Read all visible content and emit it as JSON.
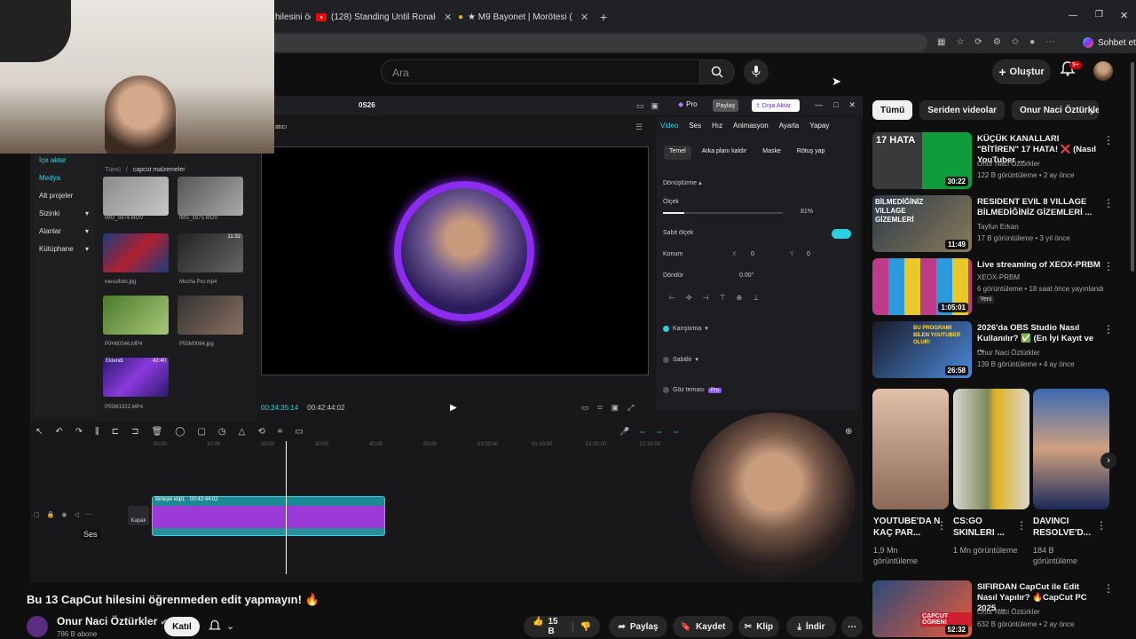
{
  "browser": {
    "tabs": [
      {
        "title": "hilesini öğ"
      },
      {
        "title": "(128) Standing Until Ronaldo Score"
      },
      {
        "title": "★ M9 Bayonet | Morötesi (Görevde"
      }
    ],
    "sohbet_label": "Sohbet et"
  },
  "youtube": {
    "search_placeholder": "Ara",
    "create_label": "Oluştur",
    "notif_count": "9+"
  },
  "capcut": {
    "title": "0S26",
    "pro_label": "Pro",
    "share_label": "Paylaş",
    "export_label": "Dışa Aktar",
    "player_label": "atıcı",
    "nav": [
      "İçe aktar",
      "Medya",
      "Alt projeler",
      "Sizinki",
      "Alanlar",
      "Kütüphane"
    ],
    "breadcrumb": [
      "Tümü",
      "capcut malzemeler"
    ],
    "media": [
      {
        "name": "IMG_5974.MOV"
      },
      {
        "name": "IMG_5975.MOV"
      },
      {
        "name": "messifoto.jpg"
      },
      {
        "name": "Mocha Pro.mp4"
      },
      {
        "name": "P0H60546.MP4"
      },
      {
        "name": "P55M0064.jpg"
      },
      {
        "name": "P55M1922.MP4"
      }
    ],
    "media_extra": {
      "tile4_time": "11:32",
      "tile7_added": "Eklendi",
      "tile7_time": "42:40"
    },
    "timecode_current": "00:24:35:14",
    "timecode_total": "00:42:44:02",
    "props_tabs": [
      "Video",
      "Ses",
      "Hız",
      "Animasyon",
      "Ayarla",
      "Yapay"
    ],
    "props_subtabs": [
      "Temel",
      "Arka planı kaldır",
      "Maske",
      "Rötuş yap"
    ],
    "transform_label": "Dönüştürme",
    "scale_label": "Ölçek",
    "scale_value": "81%",
    "uniform_scale_label": "Sabit ölçek",
    "position_label": "Konum",
    "pos_x_label": "X",
    "pos_x": "0",
    "pos_y_label": "Y",
    "pos_y": "0",
    "rotate_label": "Döndür",
    "rotate_value": "0.00°",
    "blend_label": "Karıştırma",
    "stabilize_label": "Sabitle",
    "eye_label": "Göz teması",
    "eye_badge": "Pro",
    "ruler_marks": [
      "00:00",
      "10:00",
      "20:00",
      "30:00",
      "40:00",
      "50:00",
      "01:00:00",
      "01:10:00",
      "01:20:00",
      "01:30:00"
    ],
    "clip_label": "Birleşik klip1",
    "clip_duration": "00:42:44:02",
    "cover_label": "Kapak",
    "tooltip_ses": "Ses"
  },
  "video": {
    "title": "Bu 13 CapCut hilesini öğrenmeden edit yapmayın! 🔥",
    "channel": "Onur Naci Öztürkler",
    "subscribers": "786 B abone",
    "join_label": "Katıl",
    "likes": "15 B",
    "share_label": "Paylaş",
    "save_label": "Kaydet",
    "clip_label": "Klip",
    "download_label": "İndir"
  },
  "sidebar": {
    "chips": [
      "Tümü",
      "Seriden videolar",
      "Onur Naci Öztürkler a"
    ],
    "recommendations": [
      {
        "title": "KÜÇÜK KANALLARI \"BİTİREN\" 17 HATA! ❌ (Nasıl YouTuber ...",
        "channel": "Onur Naci Öztürkler",
        "meta": "122 B görüntüleme • 2 ay önce",
        "duration": "30:22",
        "thumb_text": "17 HATA"
      },
      {
        "title": "RESIDENT EVIL 8 VILLAGE BİLMEDİĞİNİZ GİZEMLERİ ...",
        "channel": "Tayfun Erkan",
        "meta": "17 B görüntüleme • 3 yıl önce",
        "duration": "11:49",
        "thumb_text": "BİLMEDİĞİNİZ VILLAGE GİZEMLERİ"
      },
      {
        "title": "Live streaming of XEOX-PRBM",
        "channel": "XEOX-PRBM",
        "meta": "6 görüntüleme • 18 saat önce yayınlandı",
        "duration": "1:05:01",
        "badge": "Yeni"
      },
      {
        "title": "2026'da OBS Studio Nasıl Kullanılır? ✅ (En İyi Kayıt ve ...",
        "channel": "Onur Naci Öztürkler",
        "meta": "139 B görüntüleme • 4 ay önce",
        "duration": "26:58",
        "thumb_text": "BU PROGRAMI BİLEN YOUTUBER OLUR!"
      }
    ],
    "shorts": [
      {
        "title": "YOUTUBE'DA N KAÇ PAR...",
        "views": "1,9 Mn görüntüleme"
      },
      {
        "title": "CS:GO SKINLERI ...",
        "views": "1 Mn görüntüleme"
      },
      {
        "title": "DAVINCI RESOLVE'D...",
        "views": "184 B görüntüleme"
      }
    ],
    "last_rec": {
      "title": "SIFIRDAN CapCut ile Edit Nasıl Yapılır? 🔥CapCut PC 2025 ...",
      "channel": "Onur Naci Öztürkler",
      "meta": "632 B görüntüleme • 2 ay önce",
      "duration": "52:32",
      "thumb_text": "CAPCUT ÖĞREN!"
    }
  },
  "colors": {
    "accent": "#2ad0e0",
    "purple": "#8b2cf0",
    "yt_red": "#cc0000"
  }
}
